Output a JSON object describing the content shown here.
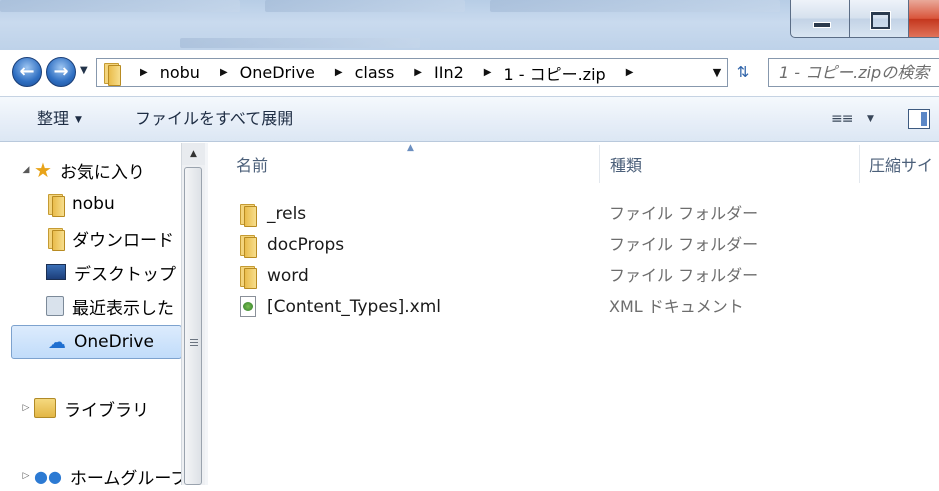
{
  "window": {
    "address_path": [
      "nobu",
      "OneDrive",
      "class",
      "IIn2",
      "1 - コピー.zip"
    ],
    "search_placeholder": "1 - コピー.zipの検索"
  },
  "commandbar": {
    "organize_label": "整理",
    "extract_label": "ファイルをすべて展開"
  },
  "navpane": {
    "favorites_label": "お気に入り",
    "items": [
      "nobu",
      "ダウンロード",
      "デスクトップ",
      "最近表示した",
      "OneDrive"
    ],
    "libraries_label": "ライブラリ",
    "homegroup_label": "ホームグループ"
  },
  "columns": {
    "name": "名前",
    "type": "種類",
    "compressed_size": "圧縮サイ"
  },
  "files": [
    {
      "name": "_rels",
      "type": "ファイル フォルダー",
      "icon": "folder-icon"
    },
    {
      "name": "docProps",
      "type": "ファイル フォルダー",
      "icon": "folder-icon"
    },
    {
      "name": "word",
      "type": "ファイル フォルダー",
      "icon": "folder-icon"
    },
    {
      "name": "[Content_Types].xml",
      "type": "XML ドキュメント",
      "icon": "xml-document-icon"
    }
  ],
  "colors": {
    "selection_bg": "#c1dcfa",
    "address_border": "#8798ad",
    "command_text": "#1e2d44"
  }
}
